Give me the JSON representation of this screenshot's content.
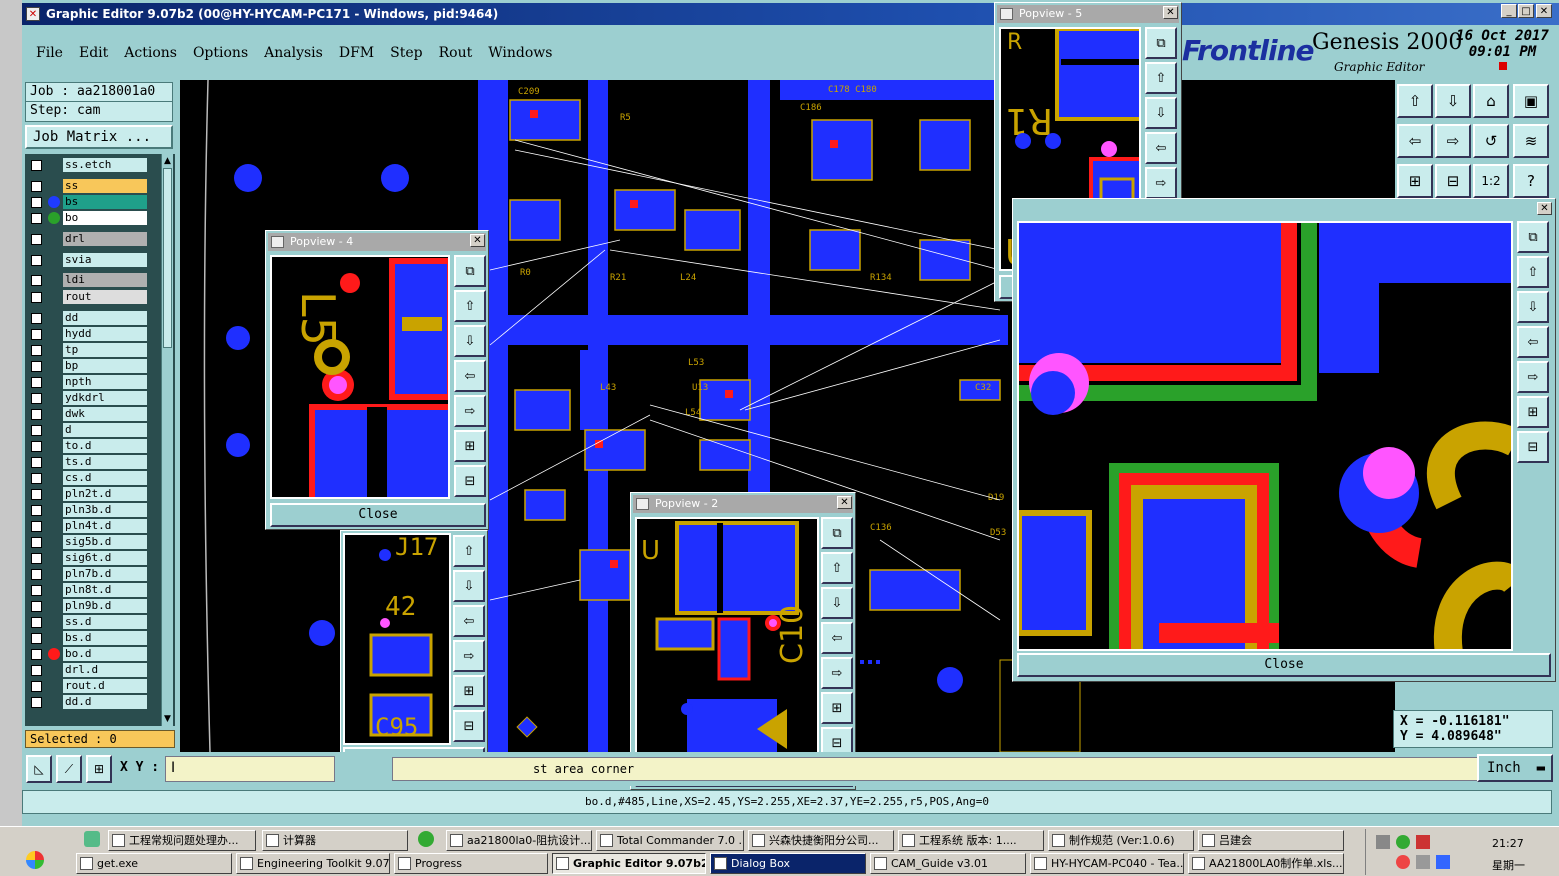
{
  "window": {
    "title": "Graphic Editor 9.07b2 (00@HY-HYCAM-PC171 - Windows, pid:9464)",
    "minimize": "_",
    "maximize": "□",
    "close": "✕"
  },
  "menu": [
    "File",
    "Edit",
    "Actions",
    "Options",
    "Analysis",
    "DFM",
    "Step",
    "Rout",
    "Windows"
  ],
  "job": {
    "job_label": "Job : aa218001a0",
    "step_label": "Step: cam",
    "matrix_button": "Job Matrix ..."
  },
  "layers": [
    {
      "name": "ss.etch",
      "bg": "#c9ecec",
      "dot": ""
    },
    {
      "name": "ss",
      "bg": "#f8c75a",
      "dot": ""
    },
    {
      "name": "bs",
      "bg": "#1fa08a",
      "dot": "#1f3bff"
    },
    {
      "name": "bo",
      "bg": "#ffffff",
      "dot": "#2aa12a"
    },
    {
      "name": "drl",
      "bg": "#b0b0b0",
      "dot": ""
    },
    {
      "name": "svia",
      "bg": "#c9ecec",
      "dot": ""
    },
    {
      "name": "ldi",
      "bg": "#b0b0b0",
      "dot": ""
    },
    {
      "name": "rout",
      "bg": "#dddddd",
      "dot": ""
    },
    {
      "name": "dd",
      "bg": "#c9ecec",
      "dot": ""
    },
    {
      "name": "hydd",
      "bg": "#c9ecec",
      "dot": ""
    },
    {
      "name": "tp",
      "bg": "#c9ecec",
      "dot": ""
    },
    {
      "name": "bp",
      "bg": "#c9ecec",
      "dot": ""
    },
    {
      "name": "npth",
      "bg": "#c9ecec",
      "dot": ""
    },
    {
      "name": "ydkdrl",
      "bg": "#c9ecec",
      "dot": ""
    },
    {
      "name": "dwk",
      "bg": "#c9ecec",
      "dot": ""
    },
    {
      "name": "d",
      "bg": "#c9ecec",
      "dot": ""
    },
    {
      "name": "to.d",
      "bg": "#c9ecec",
      "dot": ""
    },
    {
      "name": "ts.d",
      "bg": "#c9ecec",
      "dot": ""
    },
    {
      "name": "cs.d",
      "bg": "#c9ecec",
      "dot": ""
    },
    {
      "name": "pln2t.d",
      "bg": "#c9ecec",
      "dot": ""
    },
    {
      "name": "pln3b.d",
      "bg": "#c9ecec",
      "dot": ""
    },
    {
      "name": "pln4t.d",
      "bg": "#c9ecec",
      "dot": ""
    },
    {
      "name": "sig5b.d",
      "bg": "#c9ecec",
      "dot": ""
    },
    {
      "name": "sig6t.d",
      "bg": "#c9ecec",
      "dot": ""
    },
    {
      "name": "pln7b.d",
      "bg": "#c9ecec",
      "dot": ""
    },
    {
      "name": "pln8t.d",
      "bg": "#c9ecec",
      "dot": ""
    },
    {
      "name": "pln9b.d",
      "bg": "#c9ecec",
      "dot": ""
    },
    {
      "name": "ss.d",
      "bg": "#c9ecec",
      "dot": ""
    },
    {
      "name": "bs.d",
      "bg": "#c9ecec",
      "dot": ""
    },
    {
      "name": "bo.d",
      "bg": "#c9ecec",
      "dot": "#ff1a1a"
    },
    {
      "name": "drl.d",
      "bg": "#c9ecec",
      "dot": ""
    },
    {
      "name": "rout.d",
      "bg": "#c9ecec",
      "dot": ""
    },
    {
      "name": "dd.d",
      "bg": "#c9ecec",
      "dot": ""
    }
  ],
  "selected": "Selected : 0",
  "logo": {
    "brand": "Frontline",
    "product": "Genesis 2000",
    "subtitle": "Graphic Editor",
    "date": "16 Oct 2017",
    "time": "09:01 PM"
  },
  "coords": {
    "x": "X = -0.116181\"",
    "y": "Y = 4.089648\""
  },
  "input": {
    "xy_label": "X Y :",
    "prompt": "st area corner",
    "unit": "Inch"
  },
  "status": "bo.d,#485,Line,XS=2.45,YS=2.255,XE=2.37,YE=2.255,r5,POS,Ang=0",
  "popviews": {
    "p4_title": "Popview - 4",
    "p5_title": "Popview - 5",
    "p2_title": "Popview - 2",
    "close_label": "Close"
  },
  "taskbar": {
    "row1": [
      "工程常规问题处理办...",
      "计算器",
      "aa21800la0-阻抗设计...",
      "Total Commander 7.0 ...",
      "兴森快捷衡阳分公司...",
      "工程系统  版本: 1....",
      "制作规范 (Ver:1.0.6)",
      "吕建会"
    ],
    "row2": [
      "get.exe",
      "Engineering Toolkit 9.07...",
      "Progress",
      "Graphic Editor 9.07b2...",
      "Dialog Box",
      "CAM_Guide v3.01",
      "HY-HYCAM-PC040 - Tea...",
      "AA21800LA0制作单.xls..."
    ],
    "clock": "21:27",
    "weekday": "星期一"
  },
  "colors": {
    "bg": "#9ccfd0",
    "board_copper": "#1f2fff",
    "silkscreen": "#c9a300",
    "mask": "#ff1a1a",
    "green": "#2aa12a"
  }
}
